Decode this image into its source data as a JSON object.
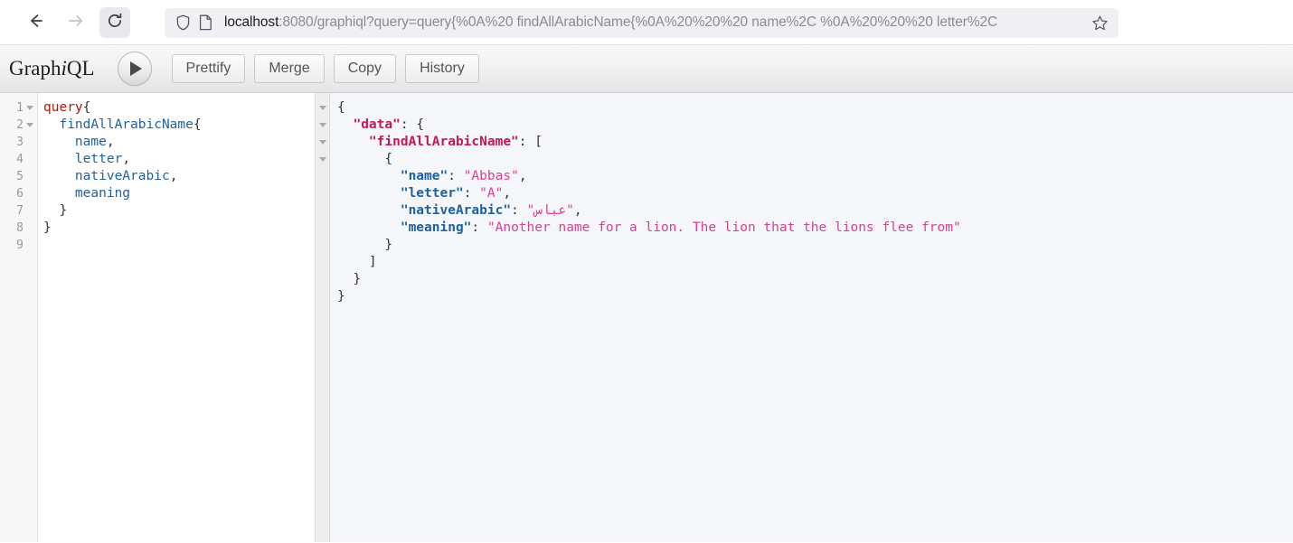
{
  "browser": {
    "back_icon": "arrow-left-icon",
    "forward_icon": "arrow-right-icon",
    "reload_icon": "reload-icon",
    "shield_icon": "shield-icon",
    "page_icon": "page-icon",
    "bookmark_icon": "star-icon",
    "url_host": "localhost",
    "url_rest": ":8080/graphiql?query=query{%0A%20 findAllArabicName{%0A%20%20%20 name%2C %0A%20%20%20 letter%2C",
    "url_full": "localhost:8080/graphiql?query=query{%0A%20 findAllArabicName{%0A%20%20%20 name%2C %0A%20%20%20 letter%2C"
  },
  "toolbar": {
    "logo_part1": "Graph",
    "logo_italic": "i",
    "logo_part2": "QL",
    "execute_icon": "play-icon",
    "execute_label": "Execute Query",
    "buttons": [
      {
        "label": "Prettify",
        "name": "prettify-button"
      },
      {
        "label": "Merge",
        "name": "merge-button"
      },
      {
        "label": "Copy",
        "name": "copy-button"
      },
      {
        "label": "History",
        "name": "history-button"
      }
    ]
  },
  "query_editor": {
    "line_numbers": [
      "1",
      "2",
      "3",
      "4",
      "5",
      "6",
      "7",
      "8",
      "9"
    ],
    "fold_lines": [
      1,
      2
    ],
    "lines": [
      {
        "n": 1,
        "tokens": [
          {
            "t": "query",
            "c": "kw"
          },
          {
            "t": "{",
            "c": "punc"
          }
        ]
      },
      {
        "n": 2,
        "tokens": [
          {
            "t": "  ",
            "c": "punc"
          },
          {
            "t": "findAllArabicName",
            "c": "fld"
          },
          {
            "t": "{",
            "c": "punc"
          }
        ]
      },
      {
        "n": 3,
        "tokens": [
          {
            "t": "    ",
            "c": "punc"
          },
          {
            "t": "name",
            "c": "fld"
          },
          {
            "t": ",",
            "c": "punc"
          }
        ]
      },
      {
        "n": 4,
        "tokens": [
          {
            "t": "    ",
            "c": "punc"
          },
          {
            "t": "letter",
            "c": "fld"
          },
          {
            "t": ",",
            "c": "punc"
          }
        ]
      },
      {
        "n": 5,
        "tokens": [
          {
            "t": "    ",
            "c": "punc"
          },
          {
            "t": "nativeArabic",
            "c": "fld"
          },
          {
            "t": ",",
            "c": "punc"
          }
        ]
      },
      {
        "n": 6,
        "tokens": [
          {
            "t": "    ",
            "c": "punc"
          },
          {
            "t": "meaning",
            "c": "fld"
          }
        ]
      },
      {
        "n": 7,
        "tokens": [
          {
            "t": "  }",
            "c": "punc"
          }
        ]
      },
      {
        "n": 8,
        "tokens": [
          {
            "t": "}",
            "c": "punc"
          }
        ]
      },
      {
        "n": 9,
        "tokens": []
      }
    ],
    "raw_text": "query{\n  findAllArabicName{\n    name,\n    letter,\n    nativeArabic,\n    meaning\n  }\n}\n"
  },
  "result_viewer": {
    "fold_count": 4,
    "lines": [
      [
        {
          "t": "{",
          "c": "punc"
        }
      ],
      [
        {
          "t": "  ",
          "c": "punc"
        },
        {
          "t": "\"data\"",
          "c": "defkey"
        },
        {
          "t": ": {",
          "c": "punc"
        }
      ],
      [
        {
          "t": "    ",
          "c": "punc"
        },
        {
          "t": "\"findAllArabicName\"",
          "c": "defkey"
        },
        {
          "t": ": [",
          "c": "punc"
        }
      ],
      [
        {
          "t": "      {",
          "c": "punc"
        }
      ],
      [
        {
          "t": "        ",
          "c": "punc"
        },
        {
          "t": "\"name\"",
          "c": "key"
        },
        {
          "t": ": ",
          "c": "punc"
        },
        {
          "t": "\"Abbas\"",
          "c": "str"
        },
        {
          "t": ",",
          "c": "punc"
        }
      ],
      [
        {
          "t": "        ",
          "c": "punc"
        },
        {
          "t": "\"letter\"",
          "c": "key"
        },
        {
          "t": ": ",
          "c": "punc"
        },
        {
          "t": "\"A\"",
          "c": "str"
        },
        {
          "t": ",",
          "c": "punc"
        }
      ],
      [
        {
          "t": "        ",
          "c": "punc"
        },
        {
          "t": "\"nativeArabic\"",
          "c": "key"
        },
        {
          "t": ": ",
          "c": "punc"
        },
        {
          "t": "\"عباس\"",
          "c": "ar"
        },
        {
          "t": ",",
          "c": "punc"
        }
      ],
      [
        {
          "t": "        ",
          "c": "punc"
        },
        {
          "t": "\"meaning\"",
          "c": "key"
        },
        {
          "t": ": ",
          "c": "punc"
        },
        {
          "t": "\"Another name for a lion. The lion that the lions flee from\"",
          "c": "str"
        }
      ],
      [
        {
          "t": "      }",
          "c": "punc"
        }
      ],
      [
        {
          "t": "    ]",
          "c": "punc"
        }
      ],
      [
        {
          "t": "  }",
          "c": "punc"
        }
      ],
      [
        {
          "t": "}",
          "c": "punc"
        }
      ]
    ],
    "response": {
      "data": {
        "findAllArabicName": [
          {
            "name": "Abbas",
            "letter": "A",
            "nativeArabic": "عباس",
            "meaning": "Another name for a lion. The lion that the lions flee from"
          }
        ]
      }
    }
  },
  "colors": {
    "keyword": "#b11a04",
    "field": "#1f61a0",
    "json_def_key": "#c2185b",
    "json_key": "#1f61a0",
    "json_string": "#d64292",
    "result_bg": "#f4f6f9",
    "toolbar_bg": "#f0f0f0"
  }
}
